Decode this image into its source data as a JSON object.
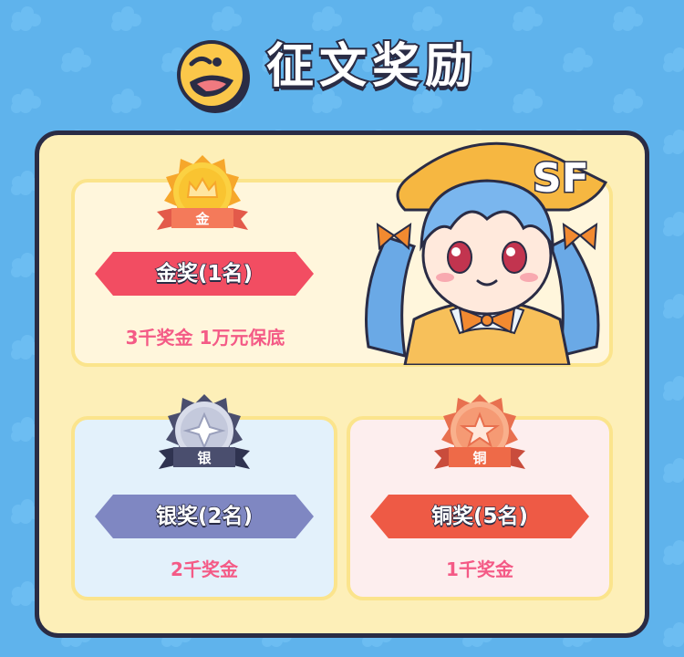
{
  "page": {
    "title": "征文奖励",
    "background_color": "#5fb3ec",
    "icon": "duck-face-icon"
  },
  "awards": {
    "gold": {
      "medal_text": "金",
      "label": "金奖(1名)",
      "prize": "3千奖金 1万元保底",
      "ribbon_color": "#f24d62",
      "medal_icon": "crown-icon"
    },
    "silver": {
      "medal_text": "银",
      "label": "银奖(2名)",
      "prize": "2千奖金",
      "ribbon_color": "#7f87c2",
      "medal_icon": "diamond-star-icon"
    },
    "bronze": {
      "medal_text": "铜",
      "label": "铜奖(5名)",
      "prize": "1千奖金",
      "ribbon_color": "#ee5a45",
      "medal_icon": "star-icon"
    }
  },
  "mascot": {
    "logo_text": "SF",
    "icon": "anime-girl-mascot"
  }
}
